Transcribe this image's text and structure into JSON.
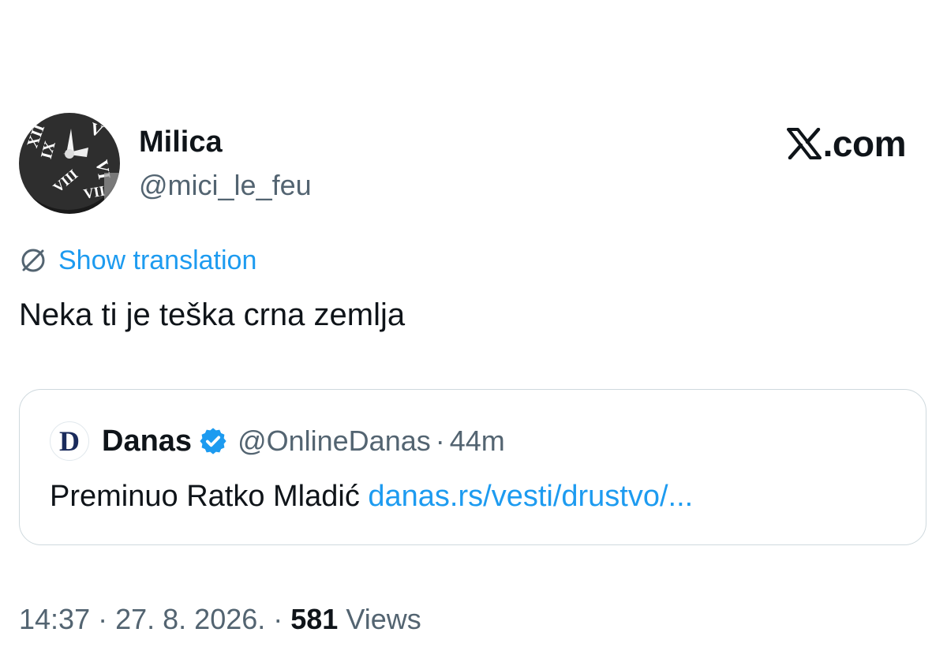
{
  "author": {
    "display_name": "Milica",
    "handle": "@mici_le_feu",
    "avatar_icon": "clock-avatar"
  },
  "brand": {
    "text": ".com",
    "icon": "x-logo-icon"
  },
  "translation": {
    "label": "Show translation",
    "icon": "translate-globe-icon"
  },
  "tweet": {
    "text": "Neka ti je teška crna zemlja"
  },
  "quote": {
    "logo_letter": "D",
    "name": "Danas",
    "verified_icon": "verified-badge-icon",
    "handle": "@OnlineDanas",
    "separator": "·",
    "time": "44m",
    "text": "Preminuo Ratko Mladić ",
    "link": "danas.rs/vesti/drustvo/..."
  },
  "meta": {
    "time": "14:37",
    "sep1": " · ",
    "date": "27. 8. 2026.",
    "sep2": " · ",
    "views_count": "581",
    "views_label": " Views"
  },
  "colors": {
    "text": "#0f1419",
    "secondary": "#536471",
    "link": "#1d9bf0",
    "border": "#cfd9de",
    "verified": "#1d9bf0"
  }
}
